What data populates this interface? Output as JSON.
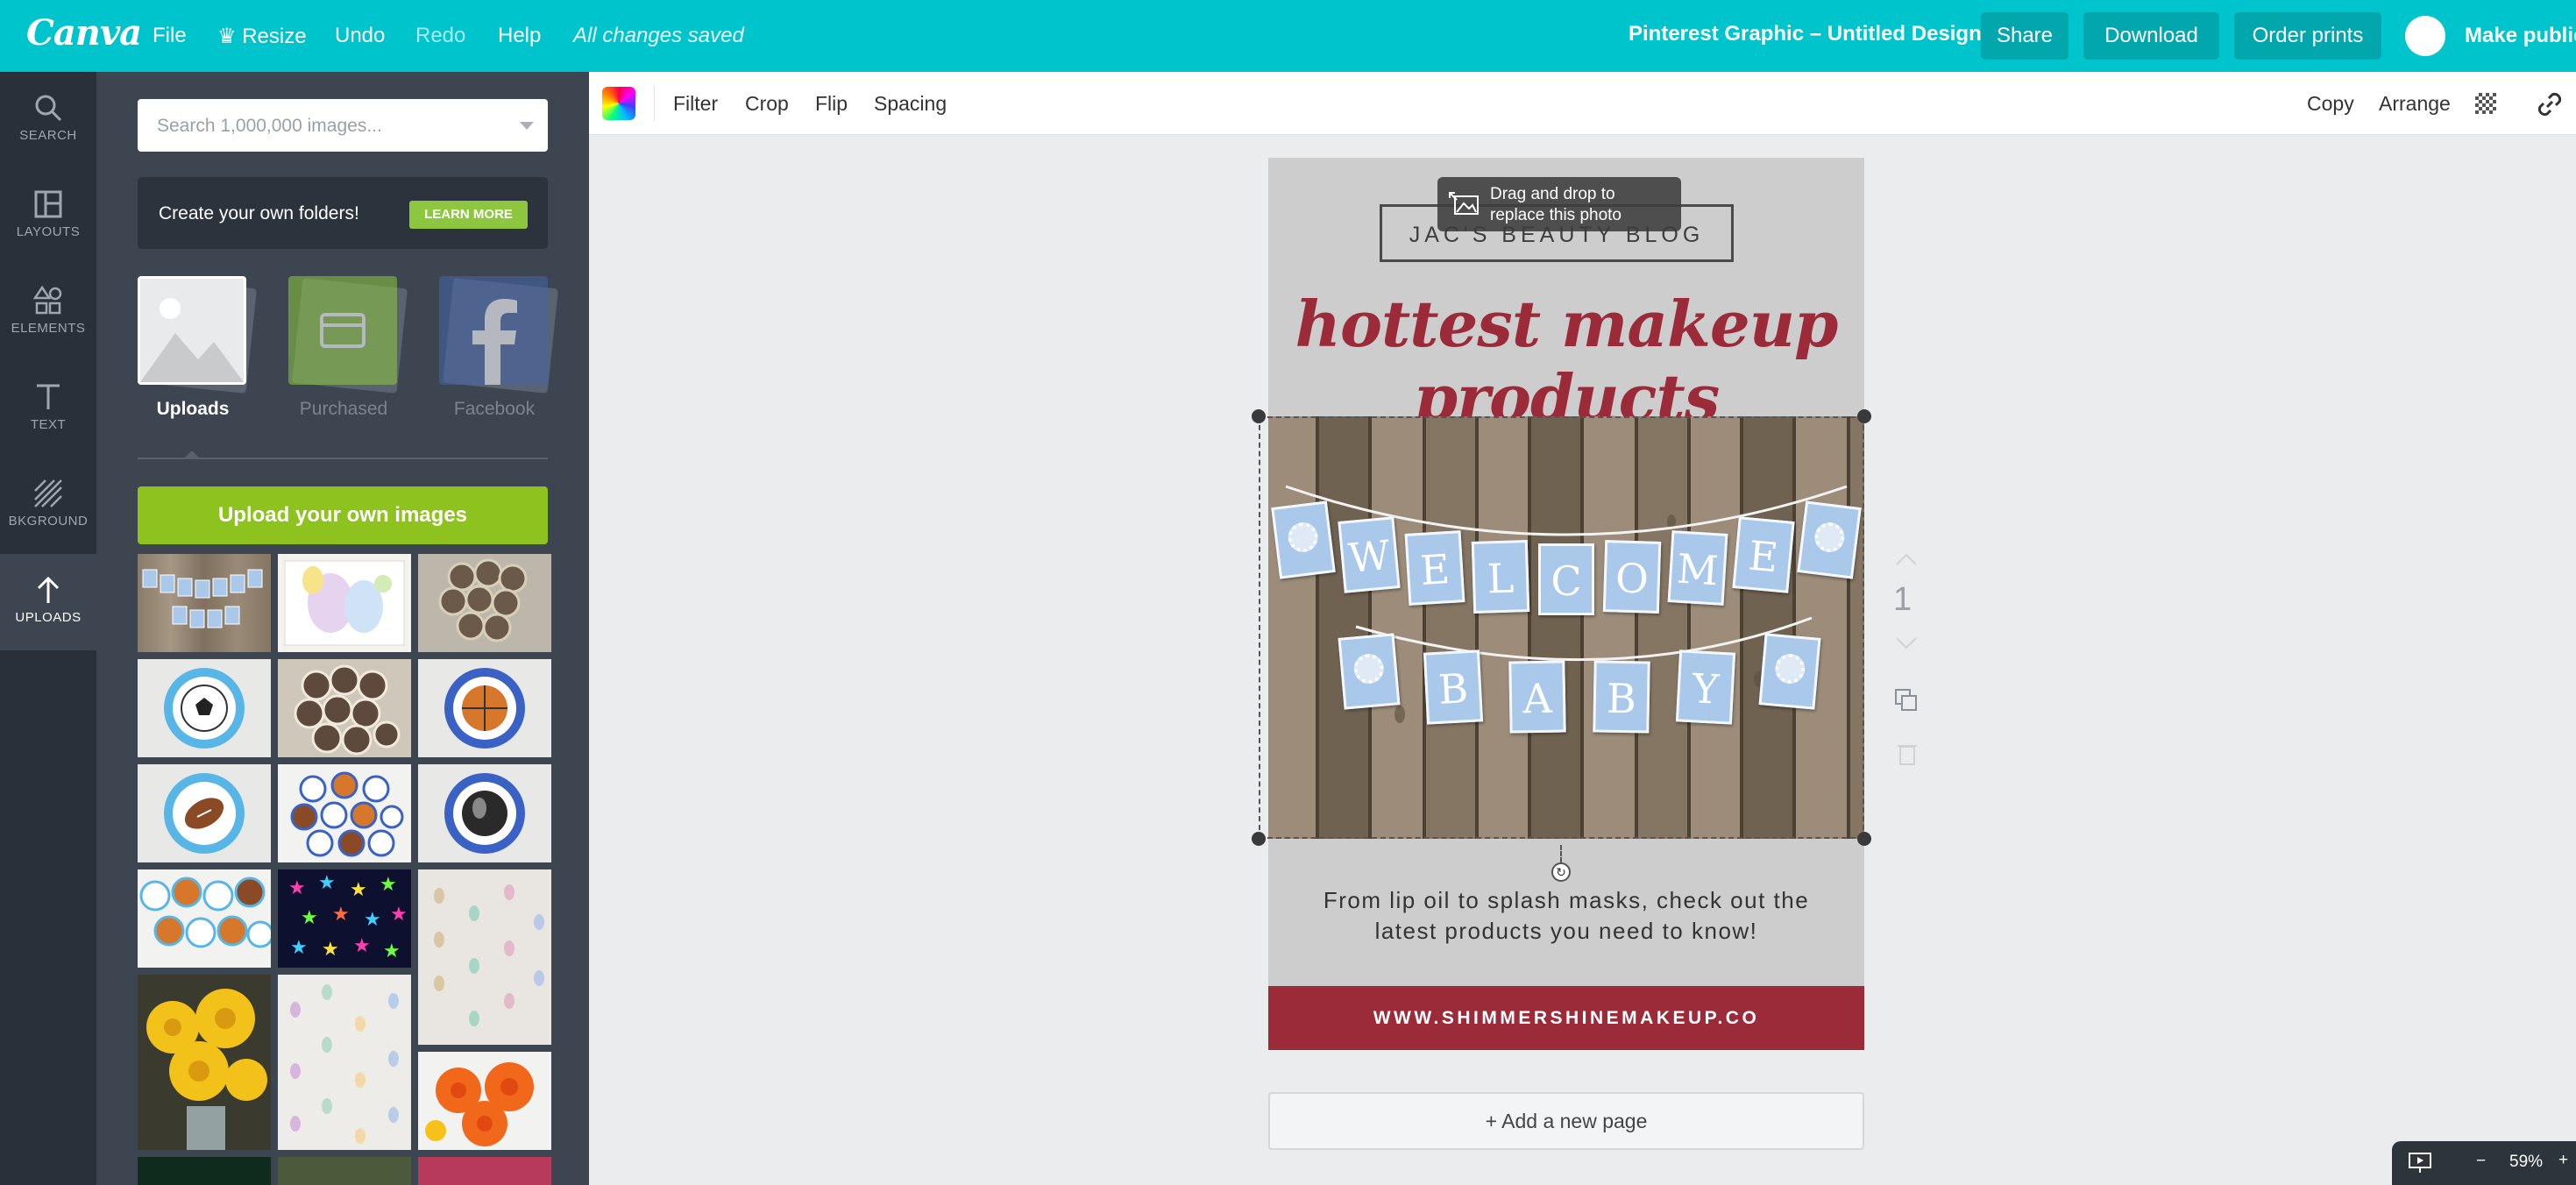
{
  "topbar": {
    "logo": "Canva",
    "file": "File",
    "resize": "Resize",
    "undo": "Undo",
    "redo": "Redo",
    "help": "Help",
    "saved_status": "All changes saved",
    "design_title": "Pinterest Graphic – Untitled Design",
    "share": "Share",
    "download": "Download",
    "order_prints": "Order prints",
    "make_public": "Make public",
    "brand_color": "#00c4cc"
  },
  "rail": {
    "search": "SEARCH",
    "layouts": "LAYOUTS",
    "elements": "ELEMENTS",
    "text": "TEXT",
    "background": "BKGROUND",
    "uploads": "UPLOADS",
    "active": "uploads"
  },
  "panel": {
    "search_placeholder": "Search 1,000,000 images...",
    "promo_text": "Create your own folders!",
    "learn_more": "LEARN MORE",
    "sources": [
      "Uploads",
      "Purchased",
      "Facebook"
    ],
    "upload_button": "Upload your own images",
    "thumbnails": [
      "welcome-baby-banner",
      "easter-eggs-painting",
      "photo-circles-heart",
      "soccer-ball-badge",
      "photo-circles-cluster",
      "basketball-badge",
      "football-badge",
      "soccer-badges-set",
      "hockey-puck-badge",
      "sports-balls-cupcake-toppers",
      "neon-stars",
      "raindrop-garland",
      "yellow-paper-flowers",
      "raindrop-garland-2",
      "orange-paper-flowers"
    ]
  },
  "toolbar": {
    "filter": "Filter",
    "crop": "Crop",
    "flip": "Flip",
    "spacing": "Spacing",
    "copy": "Copy",
    "arrange": "Arrange"
  },
  "design": {
    "blog_name": "JAC'S BEAUTY BLOG",
    "headline_line1": "hottest makeup",
    "headline_line2": "products",
    "body_line1": "From lip oil to splash masks, check out the",
    "body_line2": "latest products you need to know!",
    "website": "WWW.SHIMMERSHINEMAKEUP.CO",
    "banner_top": [
      "W",
      "E",
      "L",
      "C",
      "O",
      "M",
      "E"
    ],
    "banner_bottom": [
      "B",
      "A",
      "B",
      "Y"
    ],
    "accent_color": "#9c2b3a"
  },
  "tooltip": {
    "line1": "Drag and drop to",
    "line2": "replace this photo"
  },
  "page": {
    "number": "1",
    "add_page": "+ Add a new page"
  },
  "zoom": {
    "minus": "−",
    "level": "59%",
    "plus": "+"
  }
}
